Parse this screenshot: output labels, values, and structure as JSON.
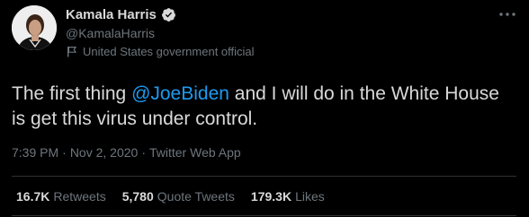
{
  "author": {
    "display_name": "Kamala Harris",
    "handle": "@KamalaHarris",
    "verified": true,
    "label": "United States government official"
  },
  "tweet": {
    "text_before": "The first thing ",
    "mention": "@JoeBiden",
    "text_after": " and I will do in the White House is get this virus under control."
  },
  "meta": {
    "time": "7:39 PM",
    "separator_1": "·",
    "date": "Nov 2, 2020",
    "separator_2": "·",
    "source": "Twitter Web App"
  },
  "stats": [
    {
      "count": "16.7K",
      "label": "Retweets"
    },
    {
      "count": "5,780",
      "label": "Quote Tweets"
    },
    {
      "count": "179.3K",
      "label": "Likes"
    }
  ],
  "colors": {
    "background": "#000000",
    "text": "#d9d9d9",
    "secondary": "#6e767d",
    "accent": "#1d9bf0",
    "divider": "#2f3336"
  },
  "icons": [
    "avatar",
    "verified-badge-icon",
    "government-flag-icon",
    "more-options-icon"
  ]
}
